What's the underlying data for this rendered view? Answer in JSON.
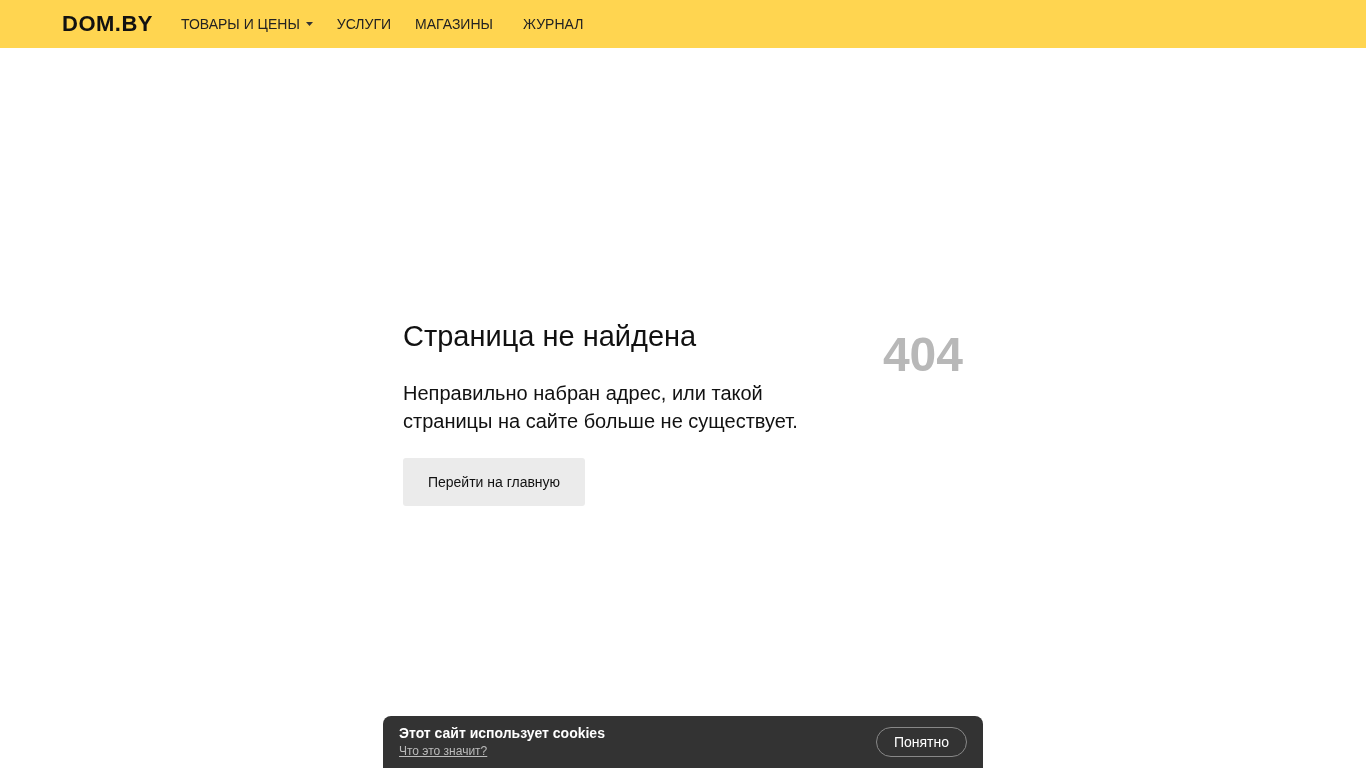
{
  "header": {
    "logo": "DOM.BY",
    "nav": [
      {
        "label": "ТОВАРЫ И ЦЕНЫ",
        "dropdown": true
      },
      {
        "label": "УСЛУГИ",
        "dropdown": false
      },
      {
        "label": "МАГАЗИНЫ",
        "dropdown": false
      },
      {
        "label": "ЖУРНАЛ",
        "dropdown": false
      }
    ]
  },
  "error": {
    "title": "Страница не найдена",
    "message": "Неправильно набран адрес, или такой страницы на сайте больше не существует.",
    "code": "404",
    "button": "Перейти на главную"
  },
  "cookie_banner": {
    "title": "Этот сайт использует cookies",
    "link": "Что это значит?",
    "button": "Понятно"
  }
}
